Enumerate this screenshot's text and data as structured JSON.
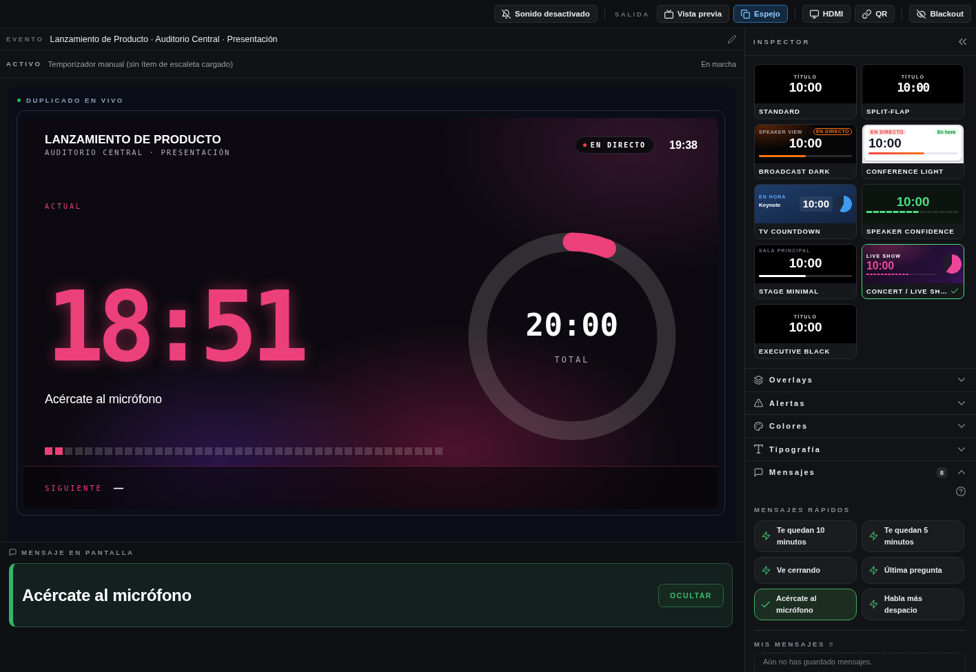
{
  "topbar": {
    "sound_button": "Sonido desactivado",
    "output_label": "SALIDA",
    "outputs": [
      {
        "kind": "preview",
        "label": "Vista previa",
        "selected": false
      },
      {
        "kind": "mirror",
        "label": "Espejo",
        "selected": true
      }
    ],
    "devices": [
      {
        "kind": "hdmi",
        "label": "HDMI"
      },
      {
        "kind": "qr",
        "label": "QR"
      }
    ],
    "blackout_button": "Blackout"
  },
  "event": {
    "label": "EVENTO",
    "name": "Lanzamiento de Producto · Auditorio Central · Presentación"
  },
  "active": {
    "label": "ACTIVO",
    "value": "Temporizador manual (sin ítem de escaleta cargado)",
    "status": "En marcha"
  },
  "live_mirror": {
    "label": "DUPLICADO EN VIVO",
    "display": {
      "title": "LANZAMIENTO DE PRODUCTO",
      "subtitle": "AUDITORIO CENTRAL · PRESENTACIÓN",
      "live_badge": "EN DIRECTO",
      "clock": "19:38",
      "current_label": "ACTUAL",
      "remaining": "18:51",
      "message": "Acércate al micrófono",
      "progress": {
        "level": 0.06
      },
      "ring": {
        "total": "20:00",
        "total_label": "TOTAL"
      },
      "next": {
        "label": "SIGUIENTE",
        "value": "—"
      }
    }
  },
  "screen_message": {
    "label": "MENSAJE EN PANTALLA",
    "text": "Acércate al micrófono",
    "hide_button": "OCULTAR"
  },
  "inspector": {
    "title": "INSPECTOR",
    "themes": [
      {
        "kind": "standard",
        "name": "STANDARD",
        "selected": false,
        "caption": "TÍTULO",
        "time": "10:00"
      },
      {
        "kind": "split-flap",
        "name": "SPLIT-FLAP",
        "selected": false,
        "caption": "TÍTULO",
        "time": "10:00"
      },
      {
        "kind": "broadcast",
        "name": "BROADCAST DARK",
        "selected": false,
        "caption": "SPEAKER VIEW",
        "badge": "EN DIRECTO",
        "time": "10:00",
        "level": 0.5
      },
      {
        "kind": "conference",
        "name": "CONFERENCE LIGHT",
        "selected": false,
        "badge": "EN DIRECTO",
        "status": "En hora",
        "time": "10:00",
        "level": 0.63
      },
      {
        "kind": "tv",
        "name": "TV COUNTDOWN",
        "selected": false,
        "status": "EN HORA",
        "caption": "Keynote",
        "time": "10:00",
        "level": 0.58
      },
      {
        "kind": "confidence",
        "name": "SPEAKER CONFIDENCE",
        "selected": false,
        "time": "10:00",
        "level": 0.57
      },
      {
        "kind": "minimal",
        "name": "STAGE MINIMAL",
        "selected": false,
        "caption": "SALA PRINCIPAL",
        "time": "10:00",
        "level": 0.5
      },
      {
        "kind": "concert",
        "name": "CONCERT / LIVE SH…",
        "selected": true,
        "caption": "LIVE SHOW",
        "time": "10:00",
        "level": 0.6
      },
      {
        "kind": "executive",
        "name": "EXECUTIVE BLACK",
        "selected": false,
        "caption": "TÍTULO",
        "time": "10:00"
      }
    ],
    "sections": [
      {
        "kind": "layers",
        "label": "Overlays",
        "expanded": false
      },
      {
        "kind": "alert",
        "label": "Alertas",
        "expanded": false
      },
      {
        "kind": "palette",
        "label": "Colores",
        "expanded": false
      },
      {
        "kind": "type",
        "label": "Tipografía",
        "expanded": false
      },
      {
        "kind": "chat",
        "label": "Mensajes",
        "expanded": true,
        "count": "8",
        "content": {
          "quick_label": "MENSAJES RÁPIDOS",
          "quick": [
            {
              "text": "Te quedan 10 minutos",
              "selected": false
            },
            {
              "text": "Te quedan 5 minutos",
              "selected": false
            },
            {
              "text": "Ve cerrando",
              "selected": false
            },
            {
              "text": "Última pregunta",
              "selected": false
            },
            {
              "text": "Acércate al micrófono",
              "selected": true
            },
            {
              "text": "Habla más despacio",
              "selected": false
            }
          ],
          "mine_label": "MIS MENSAJES",
          "mine_count": "0",
          "empty": "Aún no has guardado mensajes."
        }
      }
    ]
  }
}
